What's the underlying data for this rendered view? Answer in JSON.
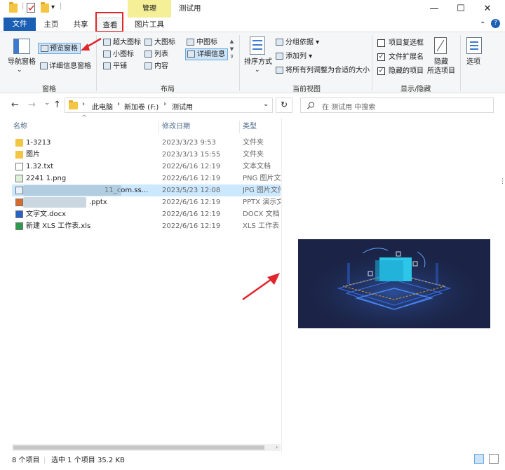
{
  "window": {
    "title": "测试用",
    "context_tab_group": "管理",
    "minimize_glyph": "—",
    "maximize_glyph": "☐",
    "close_glyph": "✕",
    "quick_access_dropdown": "▾",
    "quick_access_divider": "|"
  },
  "tabs": {
    "file": "文件",
    "home": "主页",
    "share": "共享",
    "view": "查看",
    "picture_tools": "图片工具"
  },
  "ribbon": {
    "panes": {
      "nav_pane": "导航窗格",
      "preview_pane": "预览窗格",
      "details_pane": "详细信息窗格",
      "group_label": "窗格"
    },
    "layout": {
      "extra_large": "超大图标",
      "large": "大图标",
      "medium": "中图标",
      "small": "小图标",
      "list": "列表",
      "details": "详细信息",
      "tiles": "平铺",
      "content": "内容",
      "group_label": "布局"
    },
    "current_view": {
      "sort_by": "排序方式",
      "group_by": "分组依据",
      "add_columns": "添加列",
      "size_columns": "将所有列调整为合适的大小",
      "group_label": "当前视图"
    },
    "show_hide": {
      "item_checkboxes": "项目复选框",
      "extensions": "文件扩展名",
      "hidden_items": "隐藏的项目",
      "item_checkboxes_checked": false,
      "extensions_checked": true,
      "hidden_items_checked": true,
      "hide_selected_1": "隐藏",
      "hide_selected_2": "所选项目",
      "group_label": "显示/隐藏"
    },
    "options": "选项"
  },
  "nav": {
    "back": "←",
    "forward": "→",
    "recent": "⌄",
    "up": "↑",
    "breadcrumb": [
      "此电脑",
      "新加卷 (F:)",
      "测试用"
    ],
    "separator": "›",
    "refresh": "↻",
    "search_placeholder": "在 测试用 中搜索"
  },
  "columns": {
    "name": "名称",
    "date": "修改日期",
    "type": "类型",
    "sort_glyph": "^"
  },
  "files": [
    {
      "name": "1-3213",
      "date": "2023/3/23 9:53",
      "type": "文件夹",
      "icon": "folder-icon",
      "selected": false
    },
    {
      "name": "图片",
      "date": "2023/3/13 15:55",
      "type": "文件夹",
      "icon": "folder-icon",
      "selected": false
    },
    {
      "name": "1.32.txt",
      "date": "2022/6/16 12:19",
      "type": "文本文档",
      "icon": "text-file-icon",
      "selected": false
    },
    {
      "name": "2241 1.png",
      "date": "2022/6/16 12:19",
      "type": "PNG 图片文",
      "icon": "image-file-icon",
      "selected": false
    },
    {
      "name": "11_com.ss...",
      "date": "2023/5/23 12:08",
      "type": "JPG 图片文件",
      "icon": "jpg-file-icon",
      "selected": true
    },
    {
      "name": ".pptx",
      "date": "2022/6/16 12:19",
      "type": "PPTX 演示文",
      "icon": "pptx-file-icon",
      "selected": false
    },
    {
      "name": "文字文.docx",
      "date": "2022/6/16 12:19",
      "type": "DOCX 文档",
      "icon": "docx-file-icon",
      "selected": false
    },
    {
      "name": "新建 XLS 工作表.xls",
      "date": "2022/6/16 12:19",
      "type": "XLS 工作表",
      "icon": "xls-file-icon",
      "selected": false
    }
  ],
  "status": {
    "count": "8 个项目",
    "selection": "选中 1 个项目",
    "size": "35.2 KB"
  },
  "colors": {
    "file_tab": "#1a5fb4",
    "context_tab": "#f5f097",
    "selection": "#cce8ff",
    "annotation": "#e0262c",
    "preview_bg": "#1b2446"
  }
}
